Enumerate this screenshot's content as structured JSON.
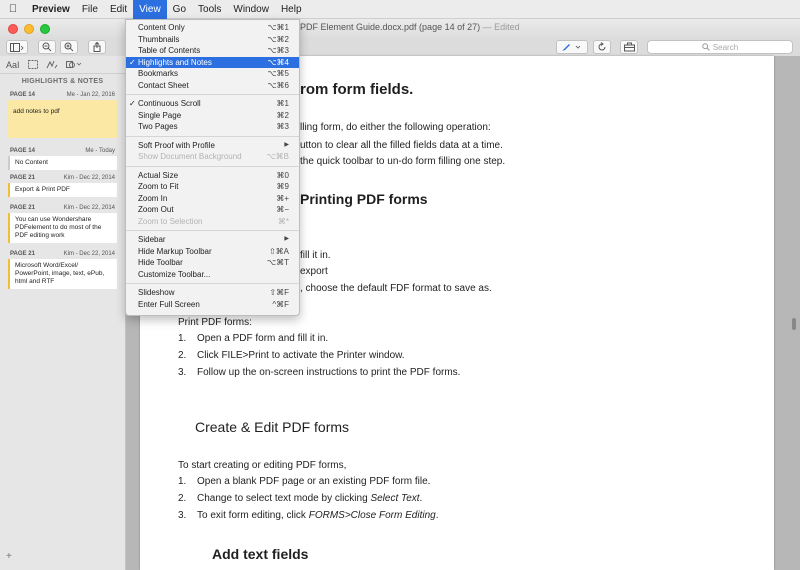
{
  "menubar": {
    "items": [
      {
        "label": "Preview"
      },
      {
        "label": "File"
      },
      {
        "label": "Edit"
      },
      {
        "label": "View"
      },
      {
        "label": "Go"
      },
      {
        "label": "Tools"
      },
      {
        "label": "Window"
      },
      {
        "label": "Help"
      }
    ]
  },
  "window": {
    "title": "PDF Element Guide.docx.pdf (page 14 of 27)",
    "edited": "— Edited"
  },
  "toolbar": {
    "search_placeholder": "Search"
  },
  "sidebar": {
    "heading": "HIGHLIGHTS & NOTES",
    "tool_text": "AaI",
    "notes": [
      {
        "page": "PAGE 14",
        "meta": "Me - Jan 22, 2016",
        "text": "add notes to pdf"
      },
      {
        "page": "PAGE 14",
        "meta": "Me - Today",
        "text": "No Content"
      },
      {
        "page": "PAGE 21",
        "meta": "Kim - Dec 22, 2014",
        "text": "Export & Print PDF"
      },
      {
        "page": "PAGE 21",
        "meta": "Kim - Dec 22, 2014",
        "text": "You can use Wondershare PDFelement to do most of the PDF editing work"
      },
      {
        "page": "PAGE 21",
        "meta": "Kim - Dec 22, 2014",
        "text": "Microsoft Word/Excel/ PowerPoint, image, text, ePub, html and RTF"
      }
    ]
  },
  "view_menu": {
    "rows": [
      {
        "label": "Content Only",
        "shortcut": "⌥⌘1"
      },
      {
        "label": "Thumbnails",
        "shortcut": "⌥⌘2"
      },
      {
        "label": "Table of Contents",
        "shortcut": "⌥⌘3"
      },
      {
        "label": "Highlights and Notes",
        "shortcut": "⌥⌘4"
      },
      {
        "label": "Bookmarks",
        "shortcut": "⌥⌘5"
      },
      {
        "label": "Contact Sheet",
        "shortcut": "⌥⌘6"
      },
      {
        "label": "Continuous Scroll",
        "shortcut": "⌘1"
      },
      {
        "label": "Single Page",
        "shortcut": "⌘2"
      },
      {
        "label": "Two Pages",
        "shortcut": "⌘3"
      },
      {
        "label": "Soft Proof with Profile",
        "shortcut": ""
      },
      {
        "label": "Show Document Background",
        "shortcut": "⌥⌘B"
      },
      {
        "label": "Actual Size",
        "shortcut": "⌘0"
      },
      {
        "label": "Zoom to Fit",
        "shortcut": "⌘9"
      },
      {
        "label": "Zoom In",
        "shortcut": "⌘+"
      },
      {
        "label": "Zoom Out",
        "shortcut": "⌘−"
      },
      {
        "label": "Zoom to Selection",
        "shortcut": "⌘*"
      },
      {
        "label": "Sidebar",
        "shortcut": ""
      },
      {
        "label": "Hide Markup Toolbar",
        "shortcut": "⇧⌘A"
      },
      {
        "label": "Hide Toolbar",
        "shortcut": "⌥⌘T"
      },
      {
        "label": "Customize Toolbar...",
        "shortcut": ""
      },
      {
        "label": "Slideshow",
        "shortcut": "⇧⌘F"
      },
      {
        "label": "Enter Full Screen",
        "shortcut": "^⌘F"
      }
    ],
    "checkmark": "✓"
  },
  "document": {
    "lines": [
      "rom form fields.",
      "lling form, do either the following operation:",
      "utton to clear all the filled fields data at a time.",
      "the quick toolbar to un-do form filling one step.",
      "Printing PDF forms",
      "fill it in.",
      "export",
      ", choose the default FDF format to save as.",
      "Print PDF forms:",
      "1.",
      "Open a PDF form and fill it in.",
      "2.",
      "Click FILE>Print to activate the Printer window.",
      "3.",
      "Follow up the on-screen instructions to print the PDF forms.",
      "Create & Edit PDF forms",
      "To start creating or editing PDF forms,",
      "1.",
      "Open a blank PDF page or an existing PDF form file.",
      "2.",
      "Change to select text mode by clicking",
      "Select Text",
      ".",
      "3.",
      "To exit form editing, click",
      "FORMS>Close Form Editing",
      ".",
      "Add text fields"
    ]
  }
}
